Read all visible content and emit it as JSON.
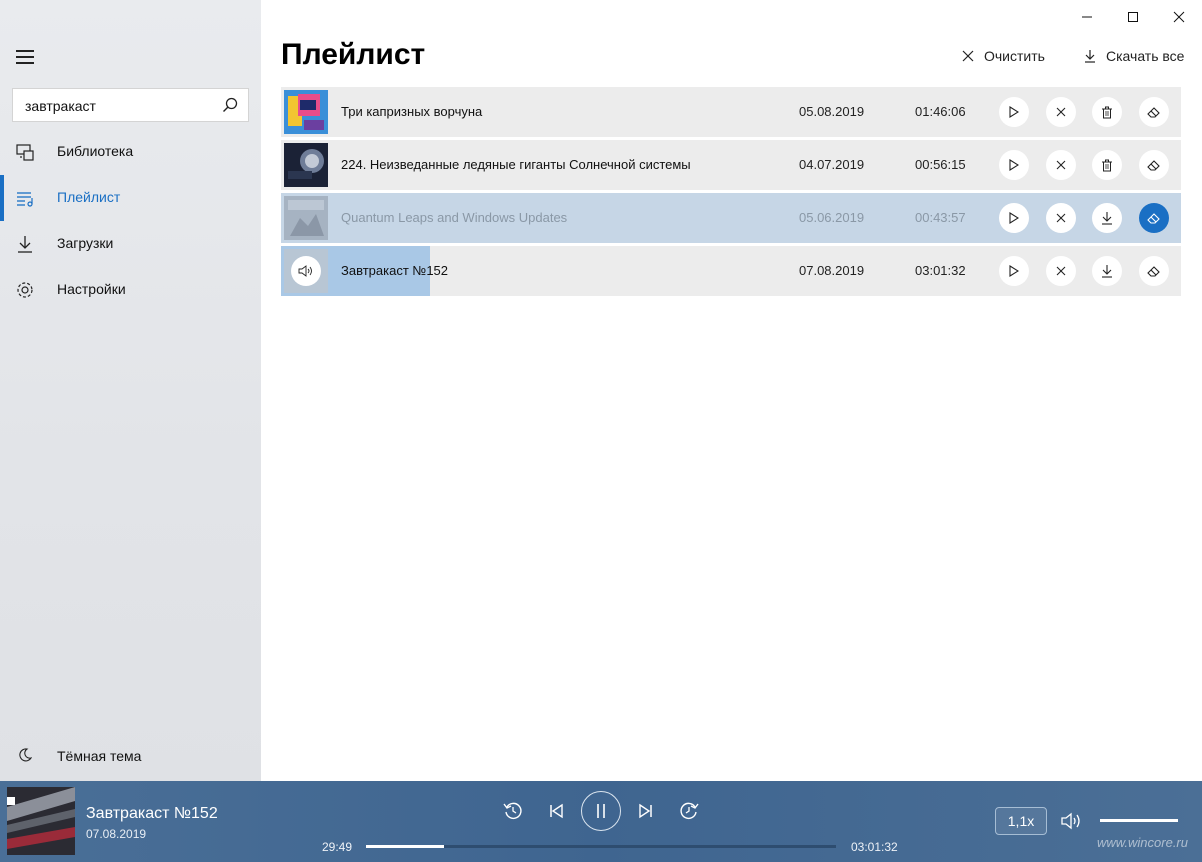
{
  "window": {
    "minimize_icon": "minimize-icon",
    "maximize_icon": "maximize-icon",
    "close_icon": "close-icon"
  },
  "sidebar": {
    "search": {
      "value": "завтракаст",
      "placeholder": ""
    },
    "items": [
      {
        "label": "Библиотека",
        "icon": "library-icon"
      },
      {
        "label": "Плейлист",
        "icon": "playlist-icon"
      },
      {
        "label": "Загрузки",
        "icon": "download-icon"
      },
      {
        "label": "Настройки",
        "icon": "gear-icon"
      }
    ],
    "theme_label": "Тёмная тема"
  },
  "main": {
    "title": "Плейлист",
    "clear_label": "Очистить",
    "download_all_label": "Скачать все",
    "rows": [
      {
        "title": "Три капризных ворчуна",
        "date": "05.08.2019",
        "duration": "01:46:06"
      },
      {
        "title": "224. Неизведанные ледяные гиганты Солнечной системы",
        "date": "04.07.2019",
        "duration": "00:56:15"
      },
      {
        "title": "Quantum Leaps and Windows Updates",
        "date": "05.06.2019",
        "duration": "00:43:57"
      },
      {
        "title": "Завтракаст №152",
        "date": "07.08.2019",
        "duration": "03:01:32"
      }
    ]
  },
  "player": {
    "title": "Завтракаст №152",
    "date": "07.08.2019",
    "elapsed": "29:49",
    "total": "03:01:32",
    "progress_fraction": 0.165,
    "speed": "1,1x",
    "watermark": "www.wincore.ru"
  },
  "colors": {
    "accent": "#1a6fc4",
    "player_bg": "#426891",
    "row_bg": "#ececec",
    "row_highlight": "#c6d6e6"
  }
}
